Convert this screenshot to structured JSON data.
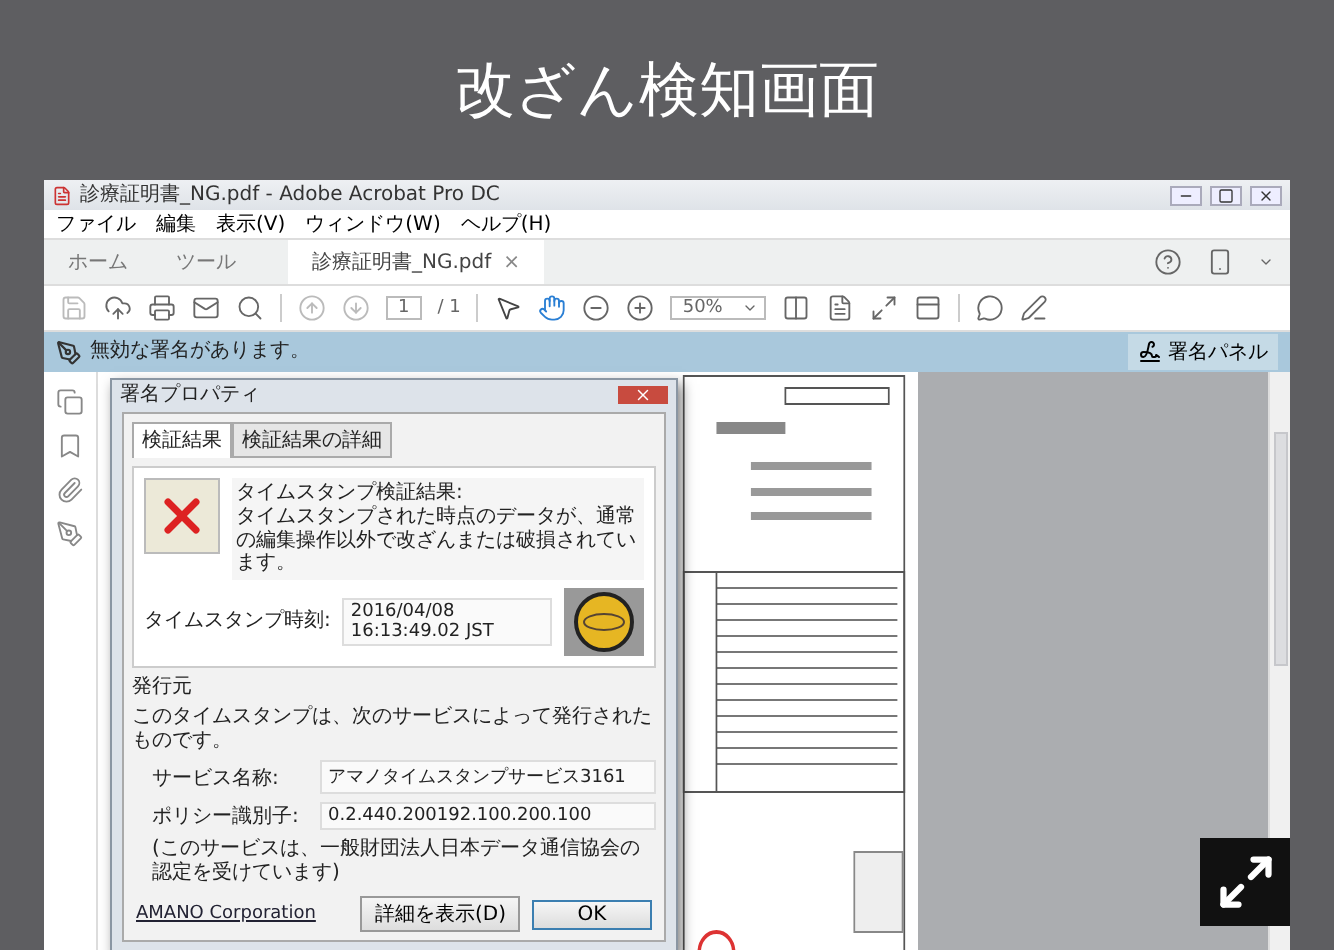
{
  "heading": "改ざん検知画面",
  "window": {
    "title": "診療証明書_NG.pdf - Adobe Acrobat Pro DC"
  },
  "menu": [
    "ファイル",
    "編集",
    "表示(V)",
    "ウィンドウ(W)",
    "ヘルプ(H)"
  ],
  "tabs": [
    {
      "label": "ホーム",
      "selected": false
    },
    {
      "label": "ツール",
      "selected": false
    },
    {
      "label": "診療証明書_NG.pdf",
      "selected": true,
      "close": "×"
    }
  ],
  "toolbar": {
    "page": "1",
    "page_total": "/ 1",
    "zoom": "50%"
  },
  "banner": {
    "message": "無効な署名があります。",
    "button": "署名パネル"
  },
  "dialog": {
    "title": "署名プロパティ",
    "tabs": [
      {
        "label": "検証結果",
        "selected": true
      },
      {
        "label": "検証結果の詳細",
        "selected": false
      }
    ],
    "result_heading": "タイムスタンプ検証結果:",
    "result_message": "タイムスタンプされた時点のデータが、通常の編集操作以外で改ざんまたは破損されています。",
    "timestamp_label": "タイムスタンプ時刻:",
    "timestamp_value": "2016/04/08 16:13:49.02 JST",
    "issuer_heading": "発行元",
    "issuer_text": "このタイムスタンプは、次のサービスによって発行されたものです。",
    "fields": [
      {
        "label": "サービス名称:",
        "value": "アマノタイムスタンプサービス3161"
      },
      {
        "label": "ポリシー識別子:",
        "value": "0.2.440.200192.100.200.100"
      }
    ],
    "note": "(このサービスは、一般財団法人日本データ通信協会の認定を受けています)",
    "link": "AMANO Corporation",
    "buttons": [
      "詳細を表示(D)",
      "OK"
    ]
  }
}
